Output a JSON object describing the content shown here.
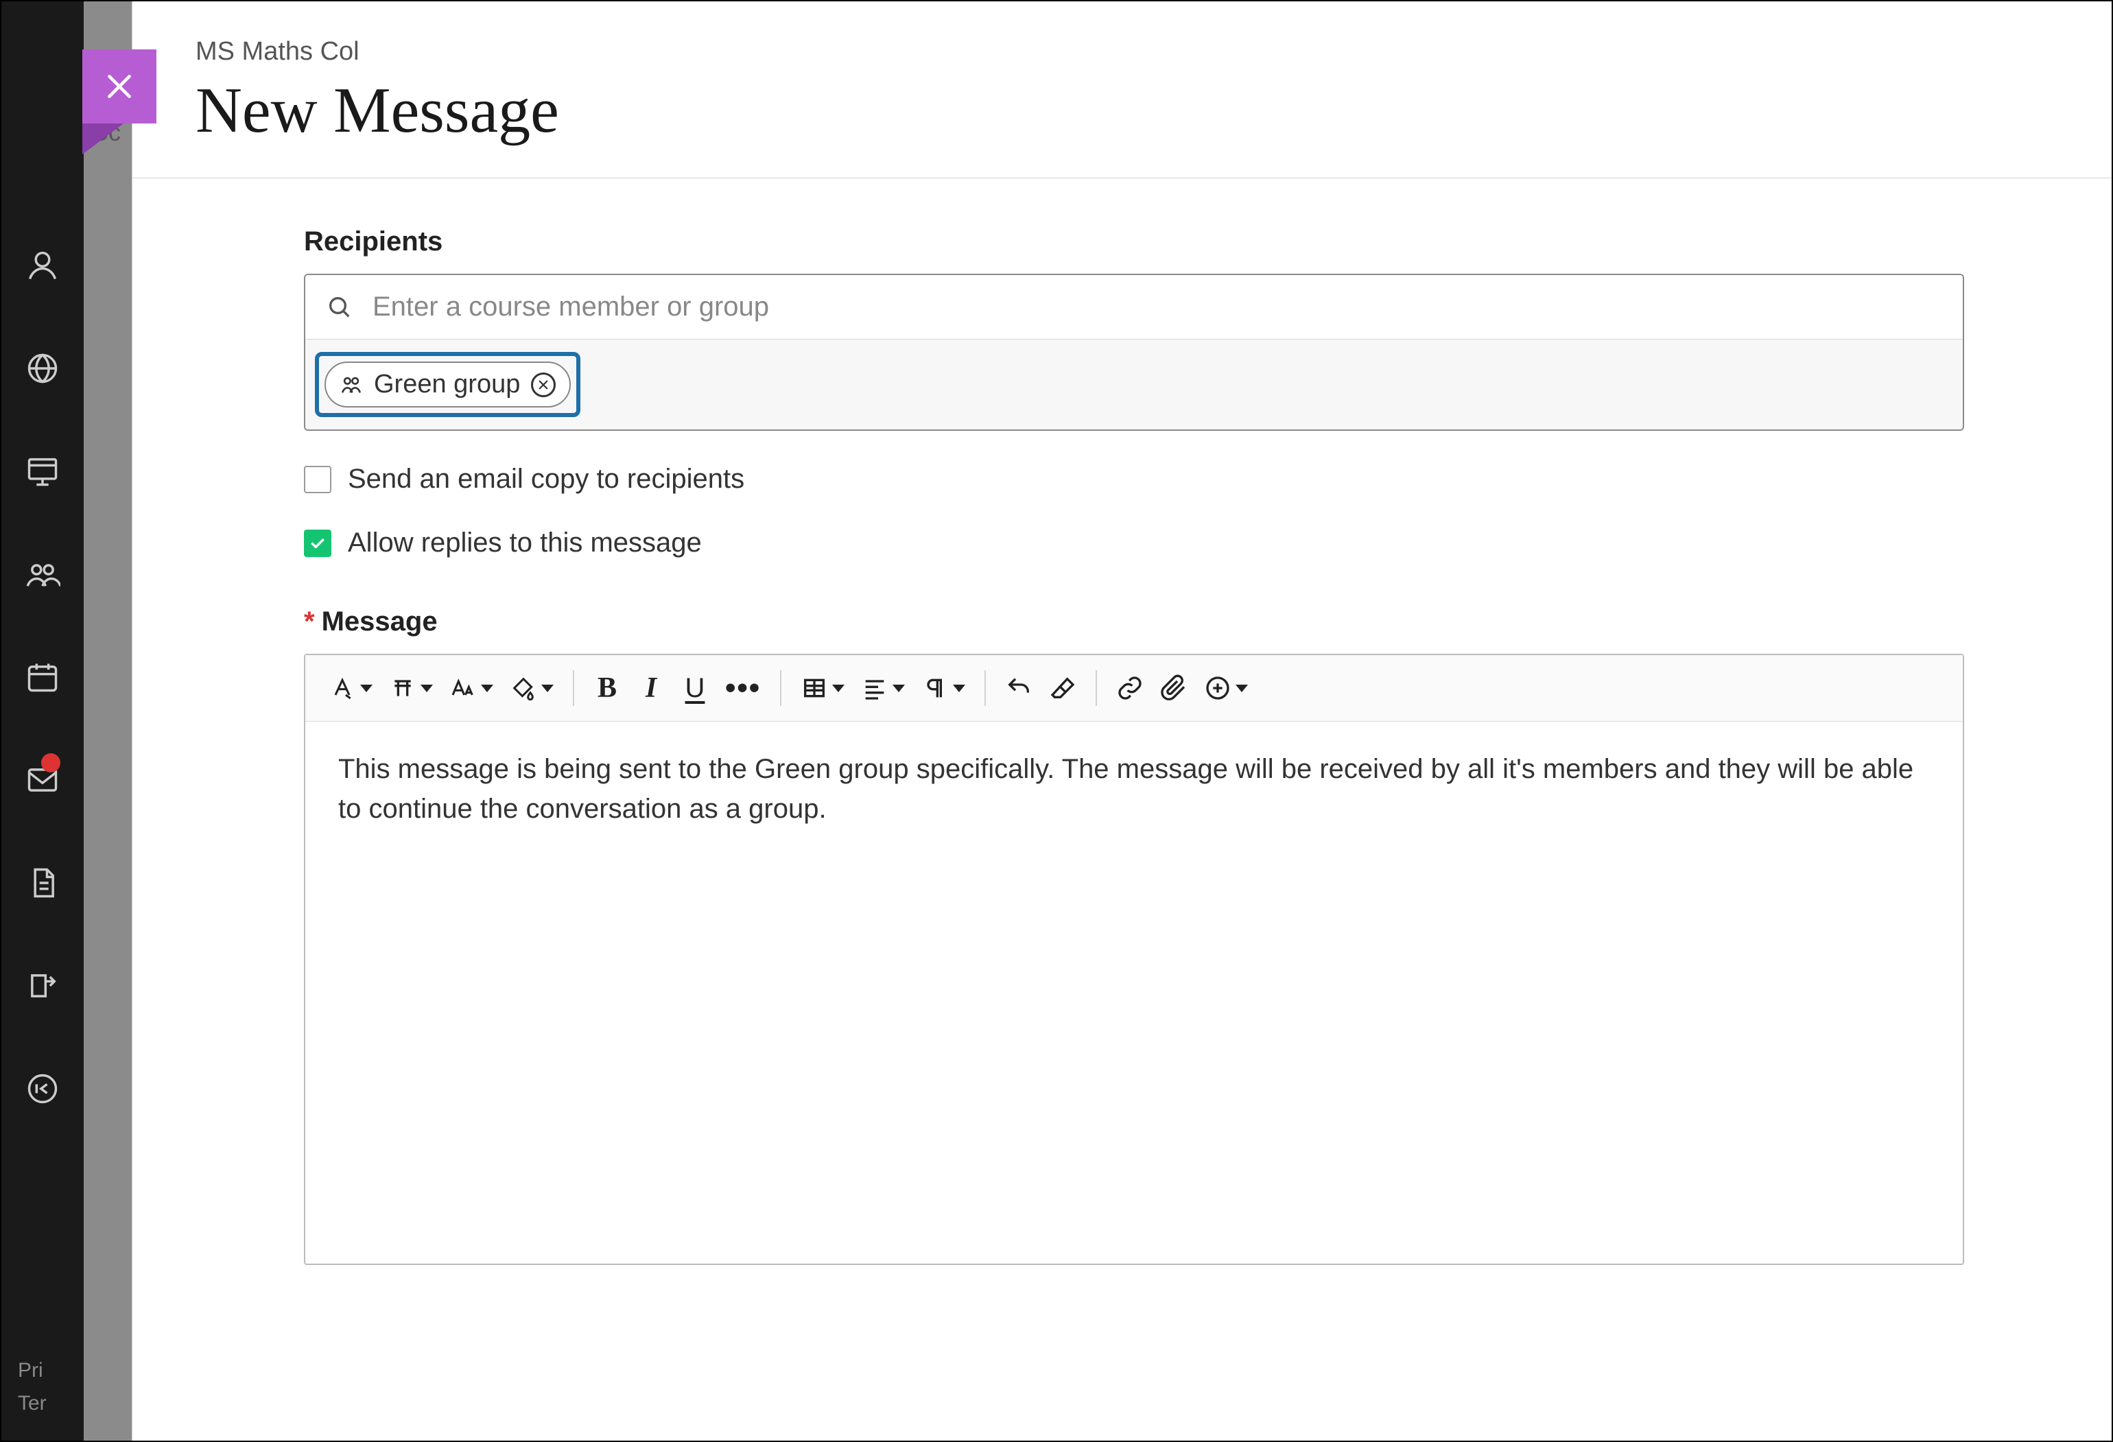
{
  "leftRail": {
    "footerLine1": "Pri",
    "footerLine2": "Ter"
  },
  "overlay": {
    "ghost1": "Cc",
    "ghost2": ""
  },
  "header": {
    "breadcrumb": "MS Maths Col",
    "title": "New Message"
  },
  "recipients": {
    "label": "Recipients",
    "placeholder": "Enter a course member or group",
    "chips": [
      {
        "label": "Green group"
      }
    ]
  },
  "options": {
    "sendEmailCopy": {
      "label": "Send an email copy to recipients",
      "checked": false
    },
    "allowReplies": {
      "label": "Allow replies to this message",
      "checked": true
    }
  },
  "message": {
    "label": "Message",
    "body": "This message is being sent to the Green group specifically. The message will be received by all it's members and they will be able to continue the conversation as a group."
  },
  "toolbar": {
    "buttons": [
      "text-style",
      "block-format",
      "font-size",
      "highlight",
      "bold",
      "italic",
      "underline",
      "more",
      "table",
      "alignment",
      "paragraph-direction",
      "undo",
      "clear-format",
      "link",
      "attachment",
      "insert-plus"
    ]
  }
}
